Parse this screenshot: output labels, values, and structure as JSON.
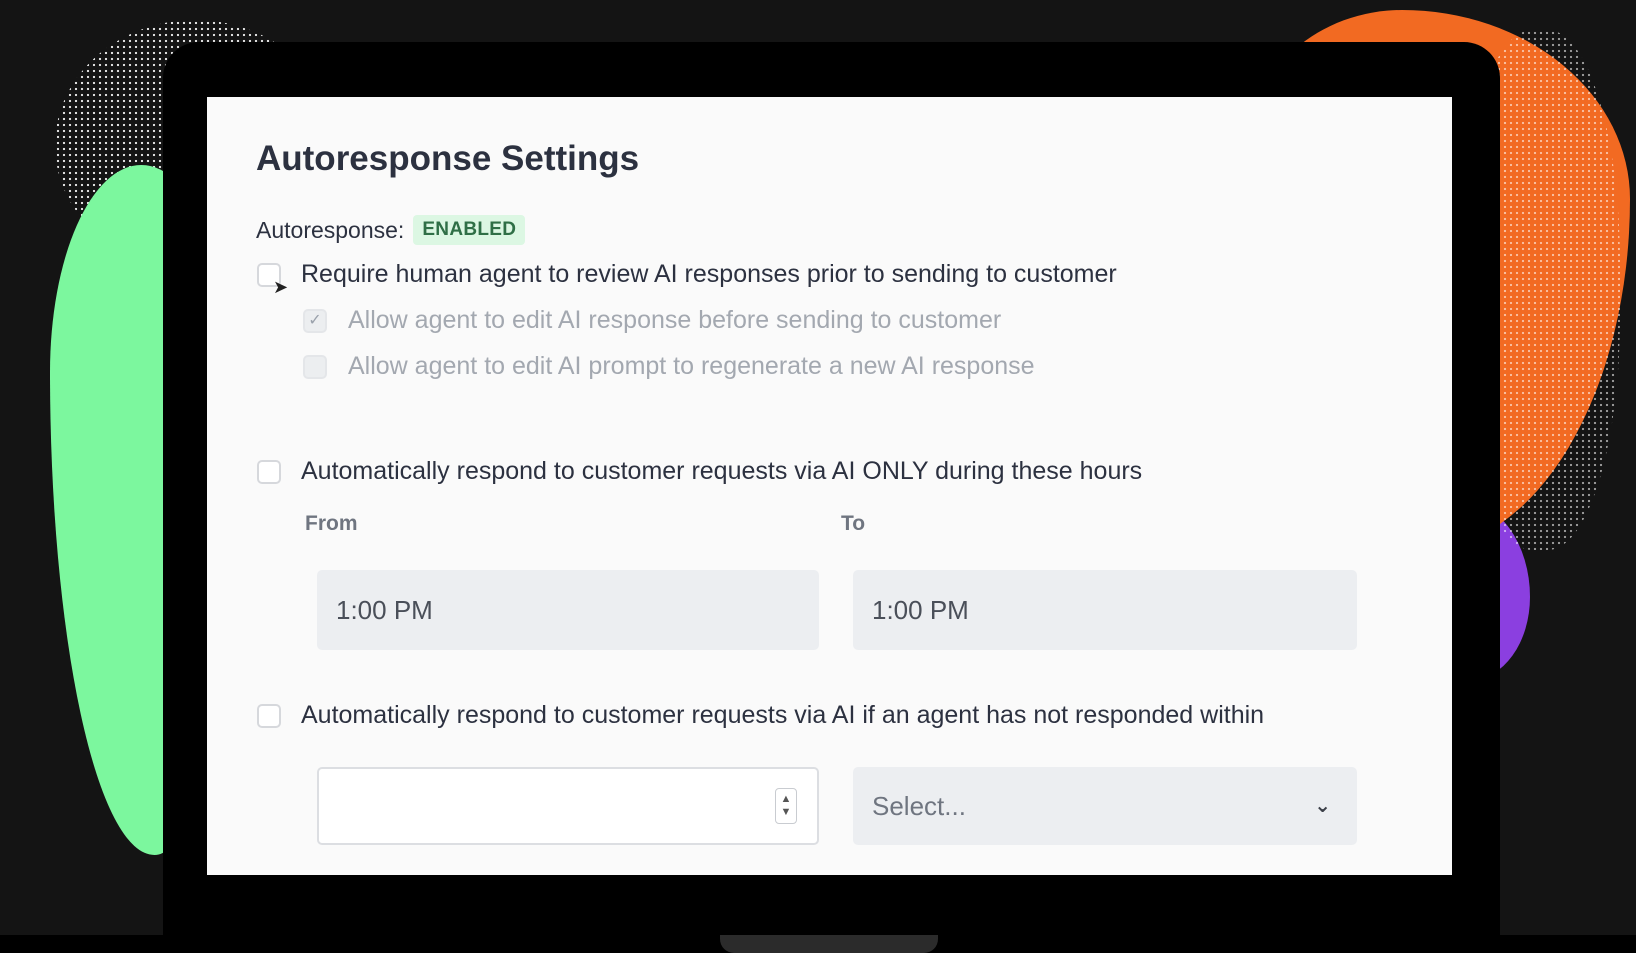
{
  "settings": {
    "title": "Autoresponse Settings",
    "status_label": "Autoresponse:",
    "status_badge": "ENABLED",
    "require_review": {
      "label": "Require human agent to review AI responses prior to sending to customer",
      "checked": false
    },
    "allow_edit_response": {
      "label": "Allow agent to edit AI response before sending to customer",
      "checked": true,
      "disabled": true
    },
    "allow_edit_prompt": {
      "label": "Allow agent to edit AI prompt to regenerate a new AI response",
      "checked": false,
      "disabled": true
    },
    "respond_hours": {
      "label": "Automatically respond to customer requests via AI ONLY during these hours",
      "checked": false,
      "from_label": "From",
      "from_value": "1:00 PM",
      "to_label": "To",
      "to_value": "1:00 PM"
    },
    "respond_timeout": {
      "label": "Automatically respond to customer requests via AI if an agent has not responded within",
      "checked": false,
      "amount_value": "",
      "unit_placeholder": "Select..."
    }
  },
  "colors": {
    "badge_bg": "#dcf7e3",
    "badge_text": "#2f6f46",
    "accent_green": "#7cf79e",
    "accent_orange": "#f26a22",
    "accent_purple": "#8b3fe0"
  },
  "icons": {
    "checkmark": "check-icon",
    "cursor": "mouse-pointer-icon",
    "spinner": "number-spinner-icon",
    "dropdown": "chevron-down-icon"
  }
}
